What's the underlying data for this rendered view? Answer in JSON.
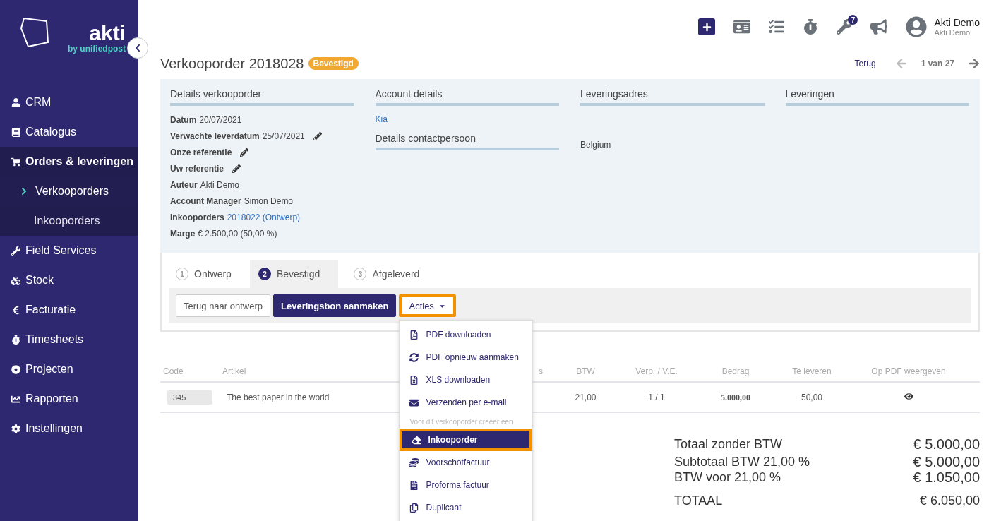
{
  "sidebar": {
    "logo": {
      "name": "akti",
      "tagline": "by unifiedpost"
    },
    "items": [
      {
        "label": "CRM",
        "selected": false
      },
      {
        "label": "Catalogus",
        "selected": false
      },
      {
        "label": "Orders & leveringen",
        "selected": true,
        "children": [
          {
            "label": "Verkooporders",
            "selected": true
          },
          {
            "label": "Inkooporders",
            "selected": false
          }
        ]
      },
      {
        "label": "Field Services",
        "selected": false
      },
      {
        "label": "Stock",
        "selected": false
      },
      {
        "label": "Facturatie",
        "selected": false
      },
      {
        "label": "Timesheets",
        "selected": false
      },
      {
        "label": "Projecten",
        "selected": false
      },
      {
        "label": "Rapporten",
        "selected": false
      },
      {
        "label": "Instellingen",
        "selected": false
      }
    ]
  },
  "topbar": {
    "notifications_badge": "7",
    "user": {
      "name": "Akti Demo",
      "company": "Akti Demo"
    }
  },
  "header": {
    "title": "Verkooporder 2018028",
    "status": "Bevestigd",
    "back": "Terug",
    "pager": "1 van 27"
  },
  "details": {
    "columns": [
      {
        "title": "Details verkooporder",
        "fields": [
          {
            "label": "Datum",
            "value": "20/07/2021",
            "kind": "text",
            "editable": false
          },
          {
            "label": "Verwachte leverdatum",
            "value": "25/07/2021",
            "kind": "text",
            "editable": true
          },
          {
            "label": "Onze referentie",
            "kind": "text",
            "editable": true
          },
          {
            "label": "Uw referentie",
            "kind": "text",
            "editable": true
          },
          {
            "label": "Auteur",
            "value": "Akti Demo",
            "kind": "text",
            "editable": false
          },
          {
            "label": "Account Manager",
            "value": "Simon Demo",
            "kind": "text",
            "editable": false
          },
          {
            "label": "Inkooporders",
            "value": "2018022 (Ontwerp)",
            "kind": "link",
            "editable": false
          },
          {
            "label": "Marge",
            "value": "€ 2.500,00 (50,00 %)",
            "kind": "text",
            "editable": false
          }
        ]
      },
      {
        "title": "Account details",
        "lines": [
          {
            "text": "Kia",
            "kind": "link"
          }
        ],
        "subsection": "Details contactpersoon"
      },
      {
        "title": "Leveringsadres",
        "lines": [
          {
            "text": "Belgium",
            "kind": "text"
          }
        ]
      },
      {
        "title": "Leveringen"
      }
    ]
  },
  "steps": [
    {
      "number": "1",
      "label": "Ontwerp",
      "selected": false
    },
    {
      "number": "2",
      "label": "Bevestigd",
      "selected": true
    },
    {
      "number": "3",
      "label": "Afgeleverd",
      "selected": false
    }
  ],
  "actions": [
    {
      "label": "Terug naar ontwerp",
      "kind": "default"
    },
    {
      "label": "Leveringsbon aanmaken",
      "kind": "primary"
    },
    {
      "label": "Acties",
      "kind": "dropdown",
      "expanded": true
    }
  ],
  "menu": [
    {
      "kind": "item",
      "label": "PDF downloaden",
      "selected": false
    },
    {
      "kind": "item",
      "label": "PDF opnieuw aanmaken",
      "selected": false
    },
    {
      "kind": "item",
      "label": "XLS downloaden",
      "selected": false
    },
    {
      "kind": "item",
      "label": "Verzenden per e-mail",
      "selected": false
    },
    {
      "kind": "header",
      "label": "Voor dit verkooporder creëer een"
    },
    {
      "kind": "item",
      "label": "Inkooporder",
      "selected": true
    },
    {
      "kind": "item",
      "label": "Voorschotfactuur",
      "selected": false
    },
    {
      "kind": "item",
      "label": "Proforma factuur",
      "selected": false
    },
    {
      "kind": "item",
      "label": "Duplicaat",
      "selected": false
    }
  ],
  "table": {
    "columns": [
      "Code",
      "Artikel",
      "s",
      "BTW",
      "Verp. / V.E.",
      "Bedrag",
      "Te leveren",
      "Op PDF weergeven"
    ],
    "rows": [
      {
        "code": "345",
        "article": "The best paper in the world",
        "btw": "21,00",
        "verp": "1 / 1",
        "amount": "5.000,00",
        "deliver": "50,00",
        "show_on_pdf": true
      }
    ]
  },
  "totals": [
    {
      "label": "Totaal zonder BTW",
      "value": "€ 5.000,00",
      "kind": "main"
    },
    {
      "label": "Subtotaal  BTW 21,00 %",
      "value": "€ 5.000,00",
      "kind": "sub"
    },
    {
      "label": "BTW voor 21,00 %",
      "value": "€ 1.050,00",
      "kind": "sub"
    },
    {
      "label": "TOTAAL",
      "value": "€ 6.050,00",
      "kind": "total"
    }
  ]
}
